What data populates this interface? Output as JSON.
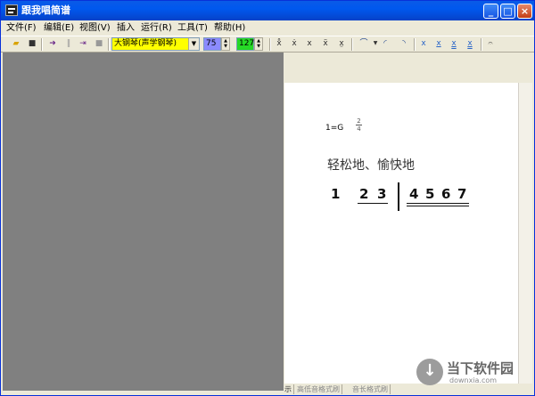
{
  "window": {
    "title": "跟我唱简谱"
  },
  "menu": [
    "文件(F)",
    "编辑(E)",
    "视图(V)",
    "插入",
    "运行(R)",
    "工具(T)",
    "帮助(H)"
  ],
  "toolbar": {
    "instrument": "大钢琴(声学钢琴)",
    "tempo": "75",
    "volume": "127",
    "tempo_color": "#8b8bff",
    "volume_color": "#26d926"
  },
  "score": {
    "key": "1=G",
    "time_top": "2",
    "time_bottom": "4",
    "lyric": "轻松地、愉快地",
    "notes": [
      "1",
      "2",
      "3",
      "4",
      "5",
      "6",
      "7"
    ]
  },
  "status": {
    "tabs": [
      "示",
      "高低音格式刷",
      "音长格式刷"
    ]
  },
  "watermark": {
    "title": "当下软件园",
    "url": "downxia.com"
  }
}
